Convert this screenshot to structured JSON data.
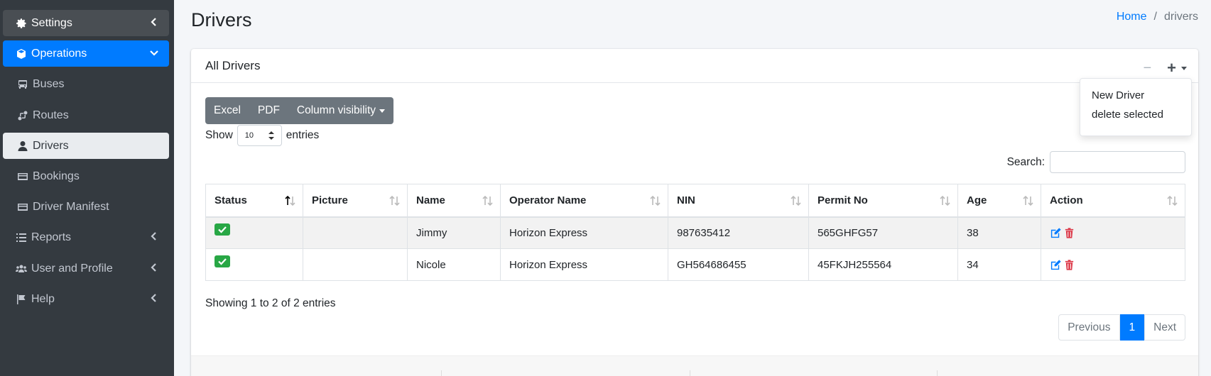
{
  "sidebar": {
    "items": [
      {
        "label": "Settings",
        "icon": "gear-icon"
      },
      {
        "label": "Operations",
        "icon": "box-icon"
      },
      {
        "label": "Buses",
        "icon": "bus-icon"
      },
      {
        "label": "Routes",
        "icon": "route-icon"
      },
      {
        "label": "Drivers",
        "icon": "user-icon"
      },
      {
        "label": "Bookings",
        "icon": "card-icon"
      },
      {
        "label": "Driver Manifest",
        "icon": "card-icon"
      },
      {
        "label": "Reports",
        "icon": "list-icon"
      },
      {
        "label": "User and Profile",
        "icon": "users-icon"
      },
      {
        "label": "Help",
        "icon": "flag-icon"
      }
    ]
  },
  "header": {
    "title": "Drivers",
    "breadcrumb": {
      "home": "Home",
      "sep": "/",
      "current": "drivers"
    }
  },
  "card": {
    "title": "All Drivers",
    "tools": {
      "minus": "−",
      "plus": "+"
    },
    "dropdown": [
      "New Driver",
      "delete selected"
    ]
  },
  "buttons": {
    "excel": "Excel",
    "pdf": "PDF",
    "colvis": "Column visibility"
  },
  "length": {
    "show": "Show",
    "value": "10",
    "entries": "entries"
  },
  "search": {
    "label": "Search:"
  },
  "table": {
    "headers": [
      "Status",
      "Picture",
      "Name",
      "Operator Name",
      "NIN",
      "Permit No",
      "Age",
      "Action"
    ],
    "rows": [
      {
        "name": "Jimmy",
        "operator": "Horizon Express",
        "nin": "987635412",
        "permit": "565GHFG57",
        "age": "38"
      },
      {
        "name": "Nicole",
        "operator": "Horizon Express",
        "nin": "GH564686455",
        "permit": "45FKJH255564",
        "age": "34"
      }
    ]
  },
  "info": "Showing 1 to 2 of 2 entries",
  "pager": {
    "prev": "Previous",
    "page": "1",
    "next": "Next"
  },
  "colors": {
    "primary": "#007bff",
    "sidebar": "#343a40",
    "success": "#28a745",
    "danger": "#dc3545"
  }
}
